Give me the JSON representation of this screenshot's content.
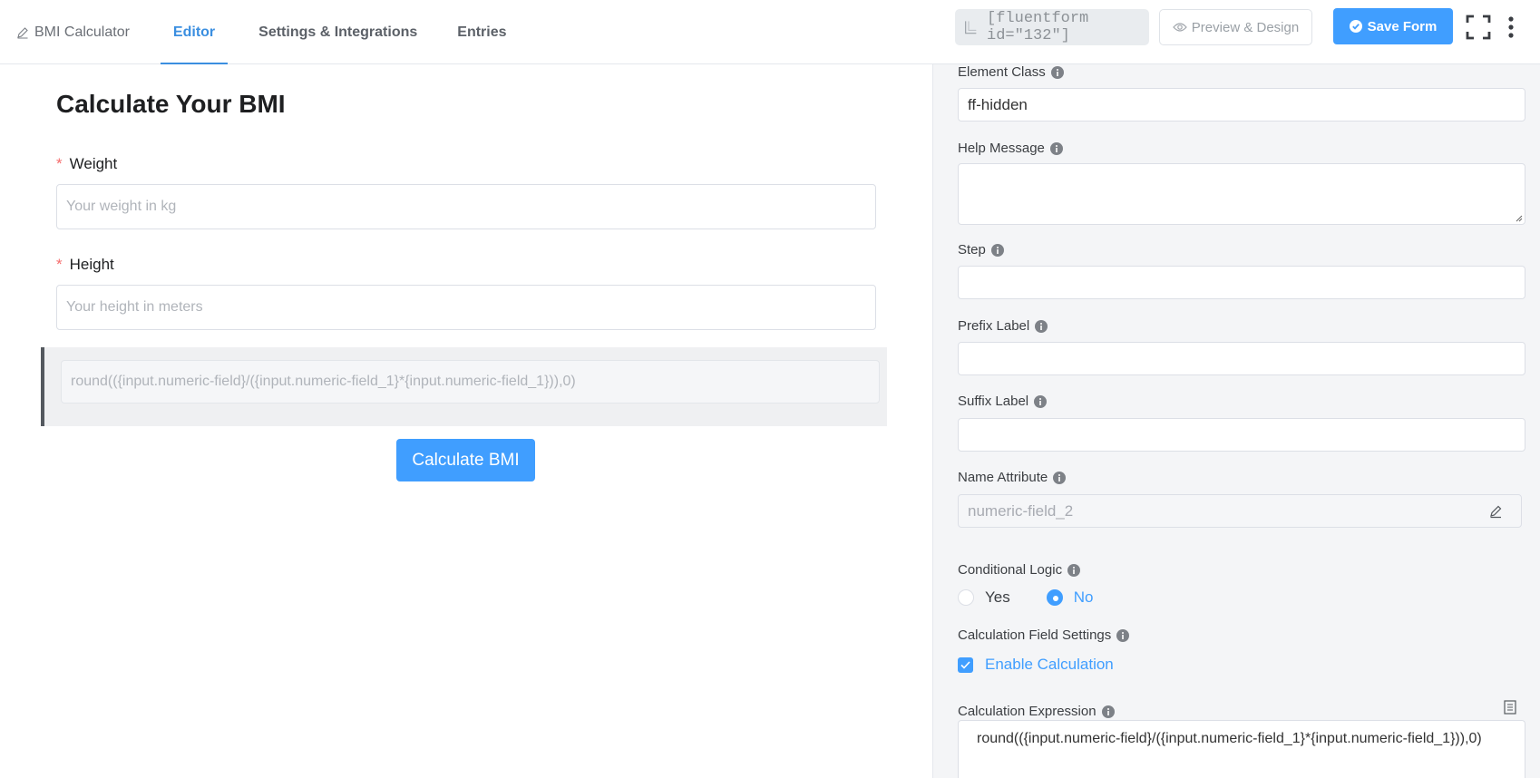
{
  "nav": {
    "brand": "BMI Calculator",
    "tabs": [
      {
        "label": "Editor"
      },
      {
        "label": "Settings & Integrations"
      },
      {
        "label": "Entries"
      }
    ]
  },
  "toolbar": {
    "shortcode": "[fluentform id=\"132\"]",
    "preview_label": "Preview & Design",
    "save_label": "Save Form"
  },
  "form": {
    "title": "Calculate Your BMI",
    "weight": {
      "label": "Weight",
      "required_mark": "*",
      "placeholder": "Your weight in kg"
    },
    "height": {
      "label": "Height",
      "required_mark": "*",
      "placeholder": "Your height in meters"
    },
    "calc_field": {
      "value": "round(({input.numeric-field}/({input.numeric-field_1}*{input.numeric-field_1})),0)"
    },
    "submit_label": "Calculate BMI"
  },
  "settings": {
    "element_class": {
      "label": "Element Class",
      "value": "ff-hidden"
    },
    "help_message": {
      "label": "Help Message",
      "value": ""
    },
    "step": {
      "label": "Step",
      "value": ""
    },
    "prefix_label": {
      "label": "Prefix Label",
      "value": ""
    },
    "suffix_label": {
      "label": "Suffix Label",
      "value": ""
    },
    "name_attribute": {
      "label": "Name Attribute",
      "value": "numeric-field_2"
    },
    "conditional_logic": {
      "label": "Conditional Logic",
      "options": [
        "Yes",
        "No"
      ],
      "selected": "No"
    },
    "calc_settings": {
      "label": "Calculation Field Settings",
      "enable_label": "Enable Calculation",
      "enabled": true
    },
    "calc_expression": {
      "label": "Calculation Expression",
      "value": "round(({input.numeric-field}/({input.numeric-field_1}*{input.numeric-field_1})),0)"
    }
  },
  "colors": {
    "accent": "#409eff",
    "required": "#f56c6c"
  }
}
